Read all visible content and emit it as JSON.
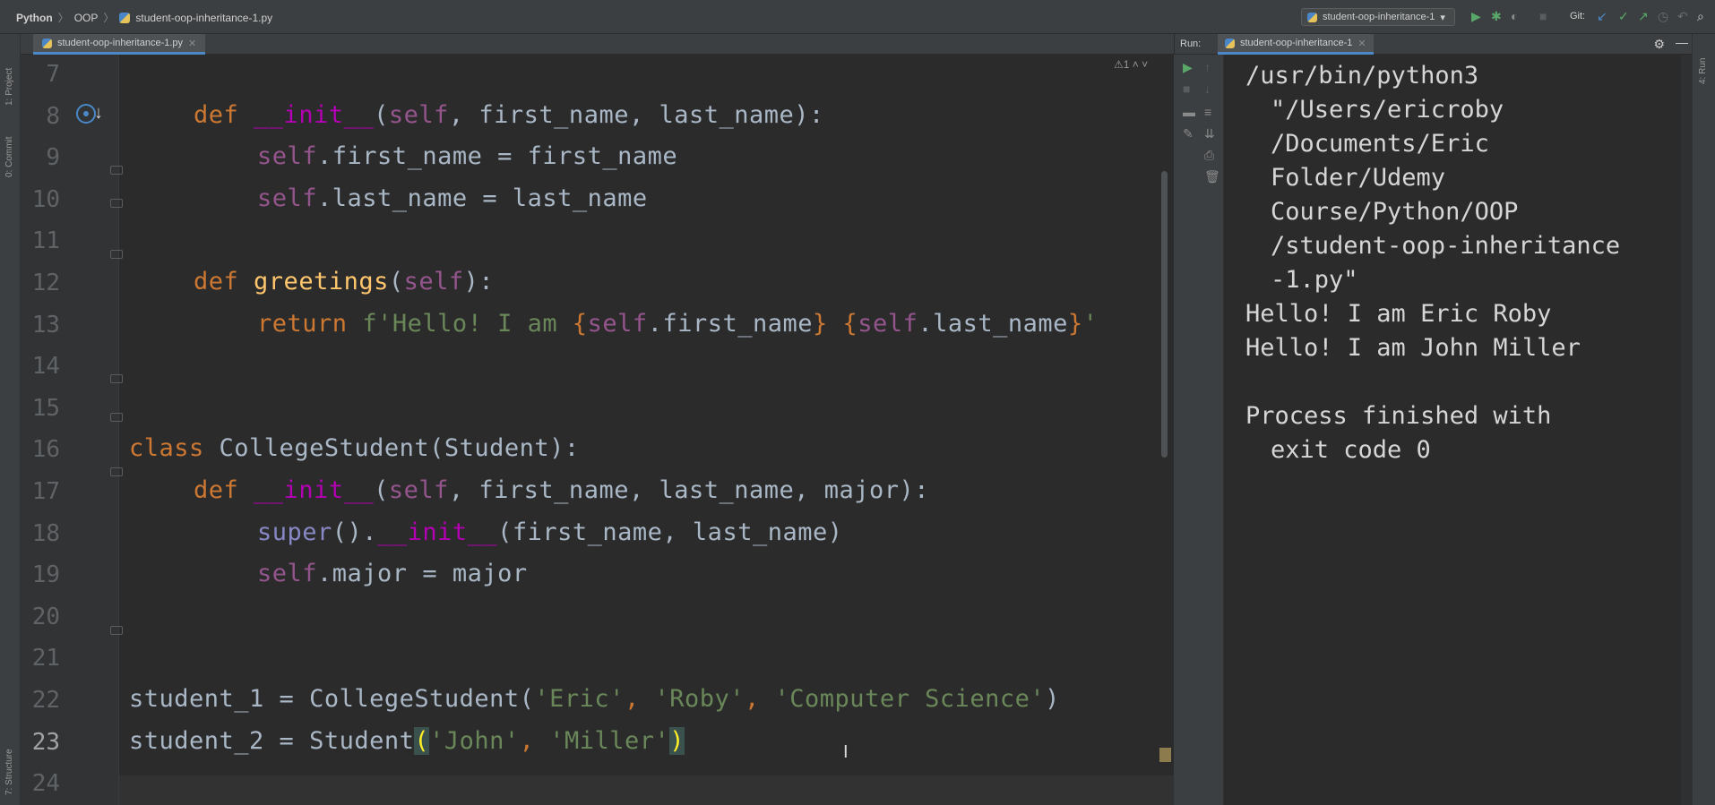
{
  "navbar": {
    "crumbs": [
      "Python",
      "OOP",
      "student-oop-inheritance-1.py"
    ],
    "run_config": "student-oop-inheritance-1",
    "git_label": "Git:"
  },
  "left_strip": {
    "project": "1: Project",
    "commit": "0: Commit",
    "structure": "7: Structure"
  },
  "editor": {
    "tab_label": "student-oop-inheritance-1.py",
    "warning_count": "1",
    "line_numbers": [
      "7",
      "8",
      "9",
      "10",
      "11",
      "12",
      "13",
      "14",
      "15",
      "16",
      "17",
      "18",
      "19",
      "20",
      "21",
      "22",
      "23",
      "24"
    ],
    "code": {
      "l8_def": "def",
      "l8_init": "__init__",
      "l8_open": "(",
      "l8_self": "self",
      "l8_rest": ", first_name, last_name):",
      "l9_self": "self",
      "l9_rest": ".first_name = first_name",
      "l10_self": "self",
      "l10_rest": ".last_name = last_name",
      "l12_def": "def",
      "l12_name": "greetings",
      "l12_open": "(",
      "l12_self": "self",
      "l12_close": "):",
      "l13_return": "return",
      "l13_fpre": "f'Hello! I am ",
      "l13_b1": "{",
      "l13_self1": "self",
      "l13_a1": ".first_name",
      "l13_b2": "}",
      "l13_sp": " ",
      "l13_b3": "{",
      "l13_self2": "self",
      "l13_a2": ".last_name",
      "l13_b4": "}",
      "l13_end": "'",
      "l16_class": "class",
      "l16_rest": " CollegeStudent(Student):",
      "l17_def": "def",
      "l17_init": "__init__",
      "l17_open": "(",
      "l17_self": "self",
      "l17_rest": ", first_name, last_name, major):",
      "l18_super": "super",
      "l18_mid": "().",
      "l18_init": "__init__",
      "l18_rest": "(first_name, last_name)",
      "l19_self": "self",
      "l19_rest": ".major = major",
      "l22_pre": "student_1 = CollegeStudent(",
      "l22_s1": "'Eric'",
      "l22_c1": ", ",
      "l22_s2": "'Roby'",
      "l22_c2": ", ",
      "l22_s3": "'Computer Science'",
      "l22_end": ")",
      "l23_pre": "student_2 = Student",
      "l23_open": "(",
      "l23_s1": "'John'",
      "l23_c1": ", ",
      "l23_s2": "'Miller'",
      "l23_close": ")"
    }
  },
  "run_panel": {
    "label": "Run:",
    "tab_label": "student-oop-inheritance-1",
    "output": [
      "/usr/bin/python3",
      "\"/Users/ericroby",
      "/Documents/Eric",
      "Folder/Udemy",
      "Course/Python/OOP",
      "/student-oop-inheritance",
      "-1.py\"",
      "Hello! I am Eric Roby",
      "Hello! I am John Miller",
      "",
      "Process finished with",
      "exit code 0"
    ]
  },
  "right_strip": {
    "run": "4: Run"
  },
  "colors": {
    "keyword": "#cc7832",
    "dunder": "#b200b2",
    "self": "#94558d",
    "function": "#ffc66d",
    "string": "#6a8759",
    "builtin": "#8888c6",
    "text": "#a9b7c6",
    "background": "#2b2b2b"
  }
}
